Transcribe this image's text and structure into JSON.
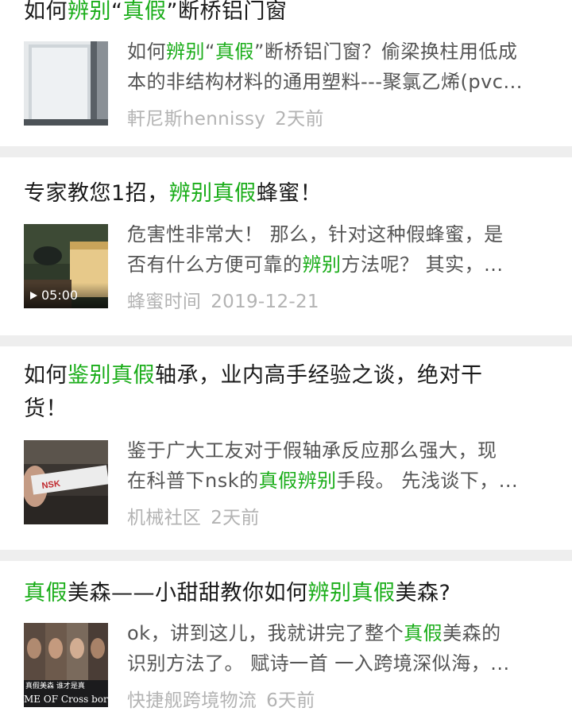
{
  "results": [
    {
      "title_parts": [
        {
          "t": "如何",
          "hl": false
        },
        {
          "t": "辨别",
          "hl": true
        },
        {
          "t": "“",
          "hl": false
        },
        {
          "t": "真假",
          "hl": true
        },
        {
          "t": "”断桥铝门窗",
          "hl": false
        }
      ],
      "snippet_line1": [
        {
          "t": "如何",
          "hl": false
        },
        {
          "t": "辨别",
          "hl": true
        },
        {
          "t": "“",
          "hl": false
        },
        {
          "t": "真假",
          "hl": true
        },
        {
          "t": "”断桥铝门窗？偷梁换柱用低成",
          "hl": false
        }
      ],
      "snippet_line2": [
        {
          "t": "本的非结构材料的通用塑料---聚氯乙烯(pvc...",
          "hl": false
        }
      ],
      "source": "軒尼斯hennissy",
      "time": "2天前"
    },
    {
      "title_parts": [
        {
          "t": "专家教您1招，",
          "hl": false
        },
        {
          "t": "辨别真假",
          "hl": true
        },
        {
          "t": "蜂蜜！",
          "hl": false
        }
      ],
      "snippet_line1": [
        {
          "t": "危害性非常大！ 那么，针对这种假蜂蜜，是",
          "hl": false
        }
      ],
      "snippet_line2": [
        {
          "t": "否有什么方便可靠的",
          "hl": false
        },
        {
          "t": "辨别",
          "hl": true
        },
        {
          "t": "方法呢？ 其实，...",
          "hl": false
        }
      ],
      "video_duration": "05:00",
      "source": "蜂蜜时间",
      "time": "2019-12-21"
    },
    {
      "title_line1": [
        {
          "t": "如何",
          "hl": false
        },
        {
          "t": "鉴别真假",
          "hl": true
        },
        {
          "t": "轴承，业内高手经验之谈，绝对干",
          "hl": false
        }
      ],
      "title_line2": [
        {
          "t": "货！",
          "hl": false
        }
      ],
      "snippet_line1": [
        {
          "t": "鉴于广大工友对于假轴承反应那么强大，现",
          "hl": false
        }
      ],
      "snippet_line2": [
        {
          "t": "在科普下nsk的",
          "hl": false
        },
        {
          "t": "真假辨别",
          "hl": true
        },
        {
          "t": "手段。 先浅谈下，...",
          "hl": false
        }
      ],
      "thumb_text": "NSK",
      "source": "机械社区",
      "time": "2天前"
    },
    {
      "title_parts": [
        {
          "t": "真假",
          "hl": true
        },
        {
          "t": "美森——小甜甜教你如何",
          "hl": false
        },
        {
          "t": "辨别真假",
          "hl": true
        },
        {
          "t": "美森?",
          "hl": false
        }
      ],
      "snippet_line1": [
        {
          "t": "ok，讲到这儿，我就讲完了整个",
          "hl": false
        },
        {
          "t": "真假",
          "hl": true
        },
        {
          "t": "美森的",
          "hl": false
        }
      ],
      "snippet_line2": [
        {
          "t": "识别方法了。 赋诗一首 一入跨境深似海，...",
          "hl": false
        }
      ],
      "thumb_caption1": "真假美森 谁才是真",
      "thumb_caption2": "ME OF Cross bor",
      "source": "快捷舰跨境物流",
      "time": "6天前"
    }
  ],
  "colors": {
    "highlight": "#1aad19",
    "meta": "#b3b3b3",
    "separator": "#eeeeee"
  }
}
